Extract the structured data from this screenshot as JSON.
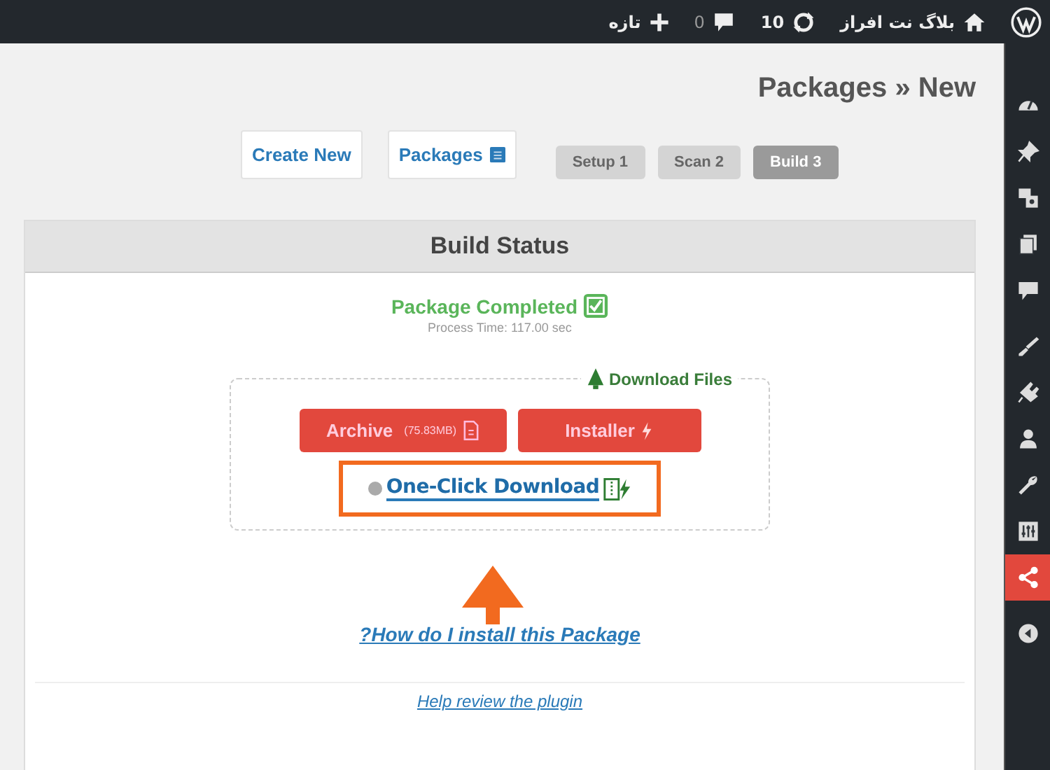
{
  "admin_bar": {
    "site_name": "بلاگ نت افراز",
    "updates": "10",
    "comments": "0",
    "new_label": "تازه"
  },
  "sidebar": {
    "items": [
      {
        "selected": false
      },
      {
        "selected": false
      },
      {
        "selected": false
      },
      {
        "selected": false
      },
      {
        "selected": false
      },
      {
        "selected": false
      },
      {
        "selected": false
      },
      {
        "selected": false
      },
      {
        "selected": false
      },
      {
        "selected": false
      },
      {
        "selected": true
      },
      {
        "selected": false
      }
    ]
  },
  "page_title": "Packages » New",
  "nav_buttons": [
    {
      "label": "Create New",
      "kind": "plain"
    },
    {
      "label": "Packages",
      "kind": "icon"
    }
  ],
  "steps": [
    {
      "label": "Setup 1",
      "selected": false
    },
    {
      "label": "Scan 2",
      "selected": false
    },
    {
      "label": "Build 3",
      "selected": true
    }
  ],
  "panel": {
    "title": "Build Status",
    "status": "Package Completed",
    "process_time": "Process Time: 117.00 sec",
    "download": {
      "legend": "Download Files",
      "buttons": [
        {
          "label": "Archive",
          "size": "(75.83MB)",
          "kind": "archive"
        },
        {
          "label": "Installer",
          "kind": "installer"
        }
      ],
      "one_click": "One-Click Download"
    },
    "install_link": "?How do I install this Package",
    "review_link": "Help review the plugin"
  }
}
